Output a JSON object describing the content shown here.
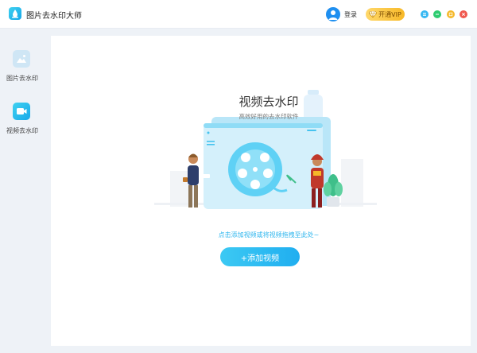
{
  "app": {
    "title": "图片去水印大师"
  },
  "header": {
    "login_label": "登录",
    "vip_label": "开通VIP"
  },
  "window_controls": [
    "menu-icon",
    "minimize-icon",
    "maximize-icon",
    "close-icon"
  ],
  "sidebar": {
    "items": [
      {
        "label": "图片去水印",
        "icon": "image-icon",
        "active": false
      },
      {
        "label": "视频去水印",
        "icon": "video-icon",
        "active": true
      }
    ]
  },
  "main": {
    "title": "视频去水印",
    "subtitle": "高效好用的去水印软件",
    "hint": "点击添加视频或将视频拖拽至此处~",
    "add_button_label": "+添加视频"
  },
  "colors": {
    "accent": "#2eb6ee",
    "vip": "#f7b928",
    "close": "#f0584e",
    "minimize": "#2ecc71",
    "maximize": "#f5b829",
    "menu": "#38b8f2"
  }
}
